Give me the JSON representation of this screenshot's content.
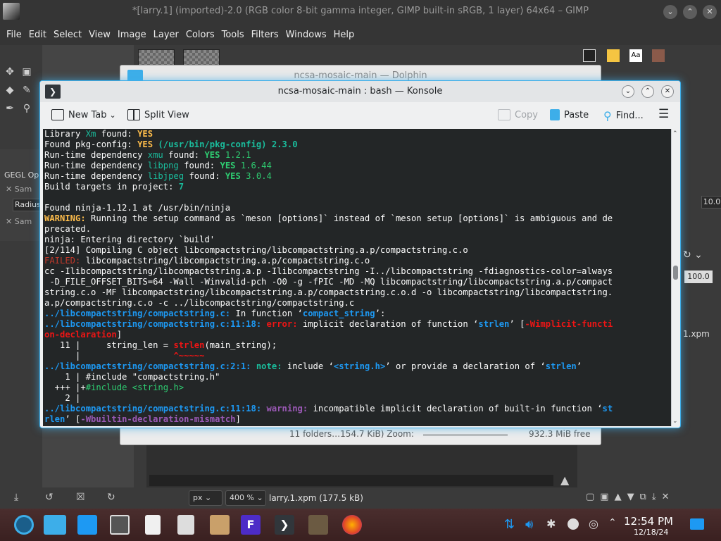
{
  "gimp": {
    "title": "*[larry.1] (imported)-2.0 (RGB color 8-bit gamma integer, GIMP built-in sRGB, 1 layer) 64x64 – GIMP",
    "menu": [
      "File",
      "Edit",
      "Select",
      "View",
      "Image",
      "Layer",
      "Colors",
      "Tools",
      "Filters",
      "Windows",
      "Help"
    ],
    "left_dock": {
      "title": "GEGL Op",
      "item1": "Sam",
      "radius": "Radius",
      "item2": "Sam"
    },
    "right_dock": {
      "value1": "10.0",
      "value2": "100.0",
      "file_tab": "1.xpm"
    },
    "status": {
      "unit": "px",
      "zoom": "400 %",
      "file": "larry.1.xpm (177.5 kB)"
    }
  },
  "dolphin": {
    "title": "ncsa-mosaic-main — Dolphin",
    "status": "11 folders…154.7 KiB) Zoom:",
    "free": "932.3 MiB free"
  },
  "konsole": {
    "title": "ncsa-mosaic-main : bash — Konsole",
    "toolbar": {
      "new_tab": "New Tab",
      "split_view": "Split View",
      "copy": "Copy",
      "paste": "Paste",
      "find": "Find..."
    },
    "lines": [
      [
        {
          "t": "Library "
        },
        {
          "t": "Xm",
          "c": "c"
        },
        {
          "t": " found: "
        },
        {
          "t": "YES",
          "c": "y"
        }
      ],
      [
        {
          "t": "Found pkg-config: "
        },
        {
          "t": "YES",
          "c": "y"
        },
        {
          "t": " (/usr/bin/pkg-config) 2.3.0",
          "c": "cb"
        }
      ],
      [
        {
          "t": "Run-time dependency "
        },
        {
          "t": "xmu",
          "c": "c"
        },
        {
          "t": " found: "
        },
        {
          "t": "YES",
          "c": "g"
        },
        {
          "t": " 1.2.1",
          "c": "gn"
        }
      ],
      [
        {
          "t": "Run-time dependency "
        },
        {
          "t": "libpng",
          "c": "c"
        },
        {
          "t": " found: "
        },
        {
          "t": "YES",
          "c": "g"
        },
        {
          "t": " 1.6.44",
          "c": "gn"
        }
      ],
      [
        {
          "t": "Run-time dependency "
        },
        {
          "t": "libjpeg",
          "c": "c"
        },
        {
          "t": " found: "
        },
        {
          "t": "YES",
          "c": "g"
        },
        {
          "t": " 3.0.4",
          "c": "gn"
        }
      ],
      [
        {
          "t": "Build targets in project: "
        },
        {
          "t": "7",
          "c": "cb"
        }
      ],
      [
        {
          "t": ""
        }
      ],
      [
        {
          "t": "Found ninja-1.12.1 at /usr/bin/ninja"
        }
      ],
      [
        {
          "t": "WARNING:",
          "c": "y"
        },
        {
          "t": " Running the setup command as `meson [options]` instead of `meson setup [options]` is ambiguous and de"
        }
      ],
      [
        {
          "t": "precated."
        }
      ],
      [
        {
          "t": "ninja: Entering directory `build'"
        }
      ],
      [
        {
          "t": "[2/114] Compiling C object libcompactstring/libcompactstring.a.p/compactstring.c.o"
        }
      ],
      [
        {
          "t": "FAILED:",
          "c": "r"
        },
        {
          "t": " libcompactstring/libcompactstring.a.p/compactstring.c.o"
        }
      ],
      [
        {
          "t": "cc -Ilibcompactstring/libcompactstring.a.p -Ilibcompactstring -I../libcompactstring -fdiagnostics-color=always"
        }
      ],
      [
        {
          "t": " -D_FILE_OFFSET_BITS=64 -Wall -Winvalid-pch -O0 -g -fPIC -MD -MQ libcompactstring/libcompactstring.a.p/compact"
        }
      ],
      [
        {
          "t": "string.c.o -MF libcompactstring/libcompactstring.a.p/compactstring.c.o.d -o libcompactstring/libcompactstring."
        }
      ],
      [
        {
          "t": "a.p/compactstring.c.o -c ../libcompactstring/compactstring.c"
        }
      ],
      [
        {
          "t": "../libcompactstring/compactstring.c:",
          "c": "bb"
        },
        {
          "t": " In function ‘"
        },
        {
          "t": "compact_string",
          "c": "bb"
        },
        {
          "t": "’:"
        }
      ],
      [
        {
          "t": "../libcompactstring/compactstring.c:11:18:",
          "c": "bb"
        },
        {
          "t": " "
        },
        {
          "t": "error:",
          "c": "rb"
        },
        {
          "t": " implicit declaration of function ‘"
        },
        {
          "t": "strlen",
          "c": "bb"
        },
        {
          "t": "’ ["
        },
        {
          "t": "-Wimplicit-functi",
          "c": "rb"
        }
      ],
      [
        {
          "t": "on-declaration",
          "c": "rb"
        },
        {
          "t": "]"
        }
      ],
      [
        {
          "t": "   11 |     string_len = "
        },
        {
          "t": "strlen",
          "c": "rb"
        },
        {
          "t": "(main_string);"
        }
      ],
      [
        {
          "t": "      |                  "
        },
        {
          "t": "^~~~~~",
          "c": "rb"
        }
      ],
      [
        {
          "t": "../libcompactstring/compactstring.c:2:1:",
          "c": "bb"
        },
        {
          "t": " "
        },
        {
          "t": "note:",
          "c": "cb"
        },
        {
          "t": " include ‘"
        },
        {
          "t": "<string.h>",
          "c": "bb"
        },
        {
          "t": "’ or provide a declaration of ‘"
        },
        {
          "t": "strlen",
          "c": "bb"
        },
        {
          "t": "’"
        }
      ],
      [
        {
          "t": "    1 | #include \"compactstring.h\""
        }
      ],
      [
        {
          "t": "  +++ |+"
        },
        {
          "t": "#include <string.h>",
          "c": "gn"
        }
      ],
      [
        {
          "t": "    2 |"
        }
      ],
      [
        {
          "t": "../libcompactstring/compactstring.c:11:18:",
          "c": "bb"
        },
        {
          "t": " "
        },
        {
          "t": "warning:",
          "c": "m"
        },
        {
          "t": " incompatible implicit declaration of built-in function ‘"
        },
        {
          "t": "st",
          "c": "bb"
        }
      ],
      [
        {
          "t": "rlen",
          "c": "bb"
        },
        {
          "t": "’ ["
        },
        {
          "t": "-Wbuiltin-declaration-mismatch",
          "c": "m"
        },
        {
          "t": "]"
        }
      ]
    ]
  },
  "taskbar": {
    "time": "12:54 PM",
    "date": "12/18/24"
  },
  "colors": {
    "accent": "#3daee9",
    "terminal_bg": "#232627",
    "taskbar": "#3a2020"
  }
}
